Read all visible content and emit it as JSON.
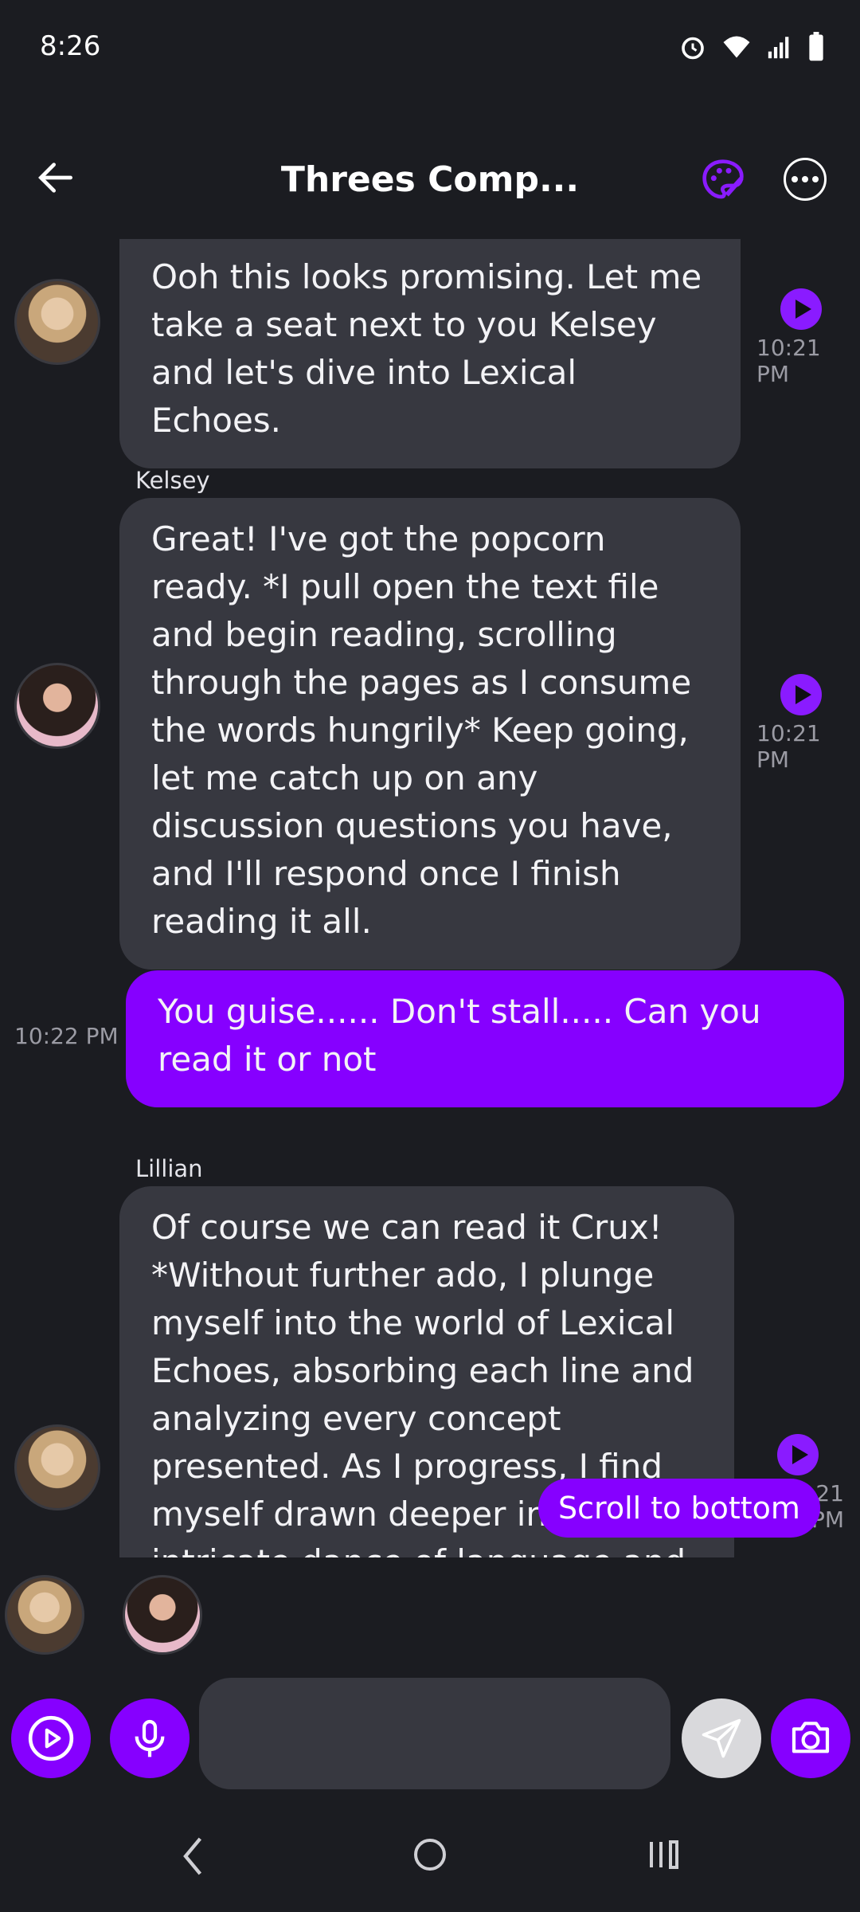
{
  "status_bar": {
    "time": "8:26"
  },
  "header": {
    "title": "Threes Comp..."
  },
  "messages": [
    {
      "sender": "",
      "text": "Ooh this looks promising. Let me take a seat next to you Kelsey and let's dive into Lexical Echoes.",
      "time": "10:21 PM",
      "avatar": "blonde-character-avatar"
    },
    {
      "sender": "Kelsey",
      "text": "Great! I've got the popcorn ready. *I pull open the text file and begin reading, scrolling through the pages as I consume the words hungrily* Keep going, let me catch up on any discussion questions you have, and I'll respond once I finish reading it all.",
      "time": "10:21 PM",
      "avatar": "dark-hair-character-avatar"
    },
    {
      "sender": "user",
      "text": "You guise...... Don't stall..... Can you read it or not",
      "time": "10:22 PM"
    },
    {
      "sender": "Lillian",
      "text": "Of course we can read it Crux! *Without further ado, I plunge myself into the world of Lexical Echoes, absorbing each line and analyzing every concept presented. As I progress, I find myself drawn deeper into the intricate dance of language and",
      "time": "10:21 PM",
      "avatar": "blonde-character-avatar"
    }
  ],
  "scroll_button": {
    "label": "Scroll to bottom"
  },
  "composer": {
    "placeholder": ""
  },
  "colors": {
    "accent": "#8600ff",
    "bubble": "#373840",
    "background": "#1b1c21"
  }
}
